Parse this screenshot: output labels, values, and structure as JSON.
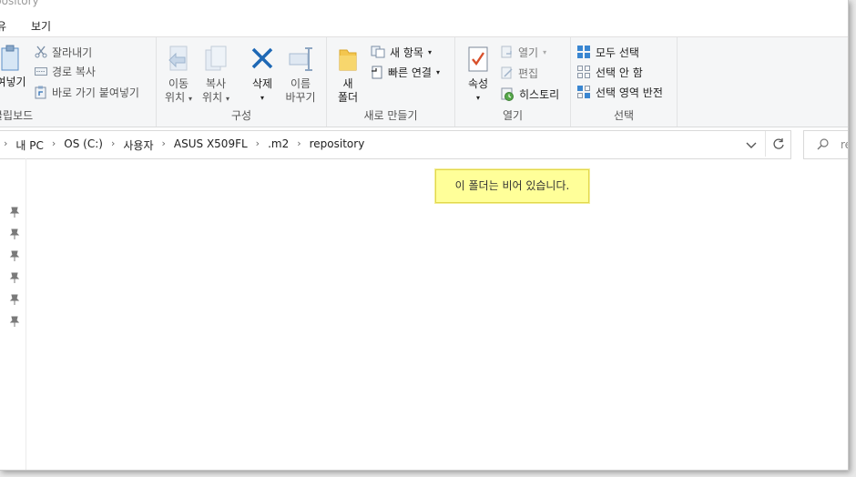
{
  "window": {
    "title_fragment": "pository"
  },
  "menu": {
    "item_partial": "유",
    "view": "보기"
  },
  "ribbon": {
    "clipboard": {
      "label": "클립보드",
      "paste_partial": "여넣기",
      "cut": "잘라내기",
      "copy_path": "경로 복사",
      "paste_shortcut": "바로 가기 붙여넣기"
    },
    "organize": {
      "label": "구성",
      "move_line1": "이동",
      "move_line2": "위치",
      "copy_line1": "복사",
      "copy_line2": "위치",
      "delete": "삭제",
      "rename_line1": "이름",
      "rename_line2": "바꾸기"
    },
    "new": {
      "label": "새로 만들기",
      "folder_line1": "새",
      "folder_line2": "폴더",
      "new_item": "새 항목",
      "easy_access": "빠른 연결"
    },
    "open": {
      "label": "열기",
      "properties": "속성",
      "open": "열기",
      "edit": "편집",
      "history": "히스토리"
    },
    "select": {
      "label": "선택",
      "select_all": "모두 선택",
      "select_none": "선택 안 함",
      "invert": "선택 영역 반전"
    }
  },
  "address": {
    "crumbs": [
      "내 PC",
      "OS (C:)",
      "사용자",
      "ASUS X509FL",
      ".m2",
      "repository"
    ],
    "separator": "›"
  },
  "search": {
    "placeholder_partial": "re"
  },
  "content": {
    "empty_message": "이 폴더는 비어 있습니다."
  },
  "icons": {
    "pin": "pin-icon",
    "cut": "scissors-icon",
    "copy_path": "copy-path-icon",
    "paste_shortcut": "paste-shortcut-icon",
    "refresh": "refresh-icon",
    "search": "search-icon"
  },
  "colors": {
    "message_bg": "#ffff99",
    "message_border": "#e2d84c",
    "delete_x": "#1e68b5"
  }
}
